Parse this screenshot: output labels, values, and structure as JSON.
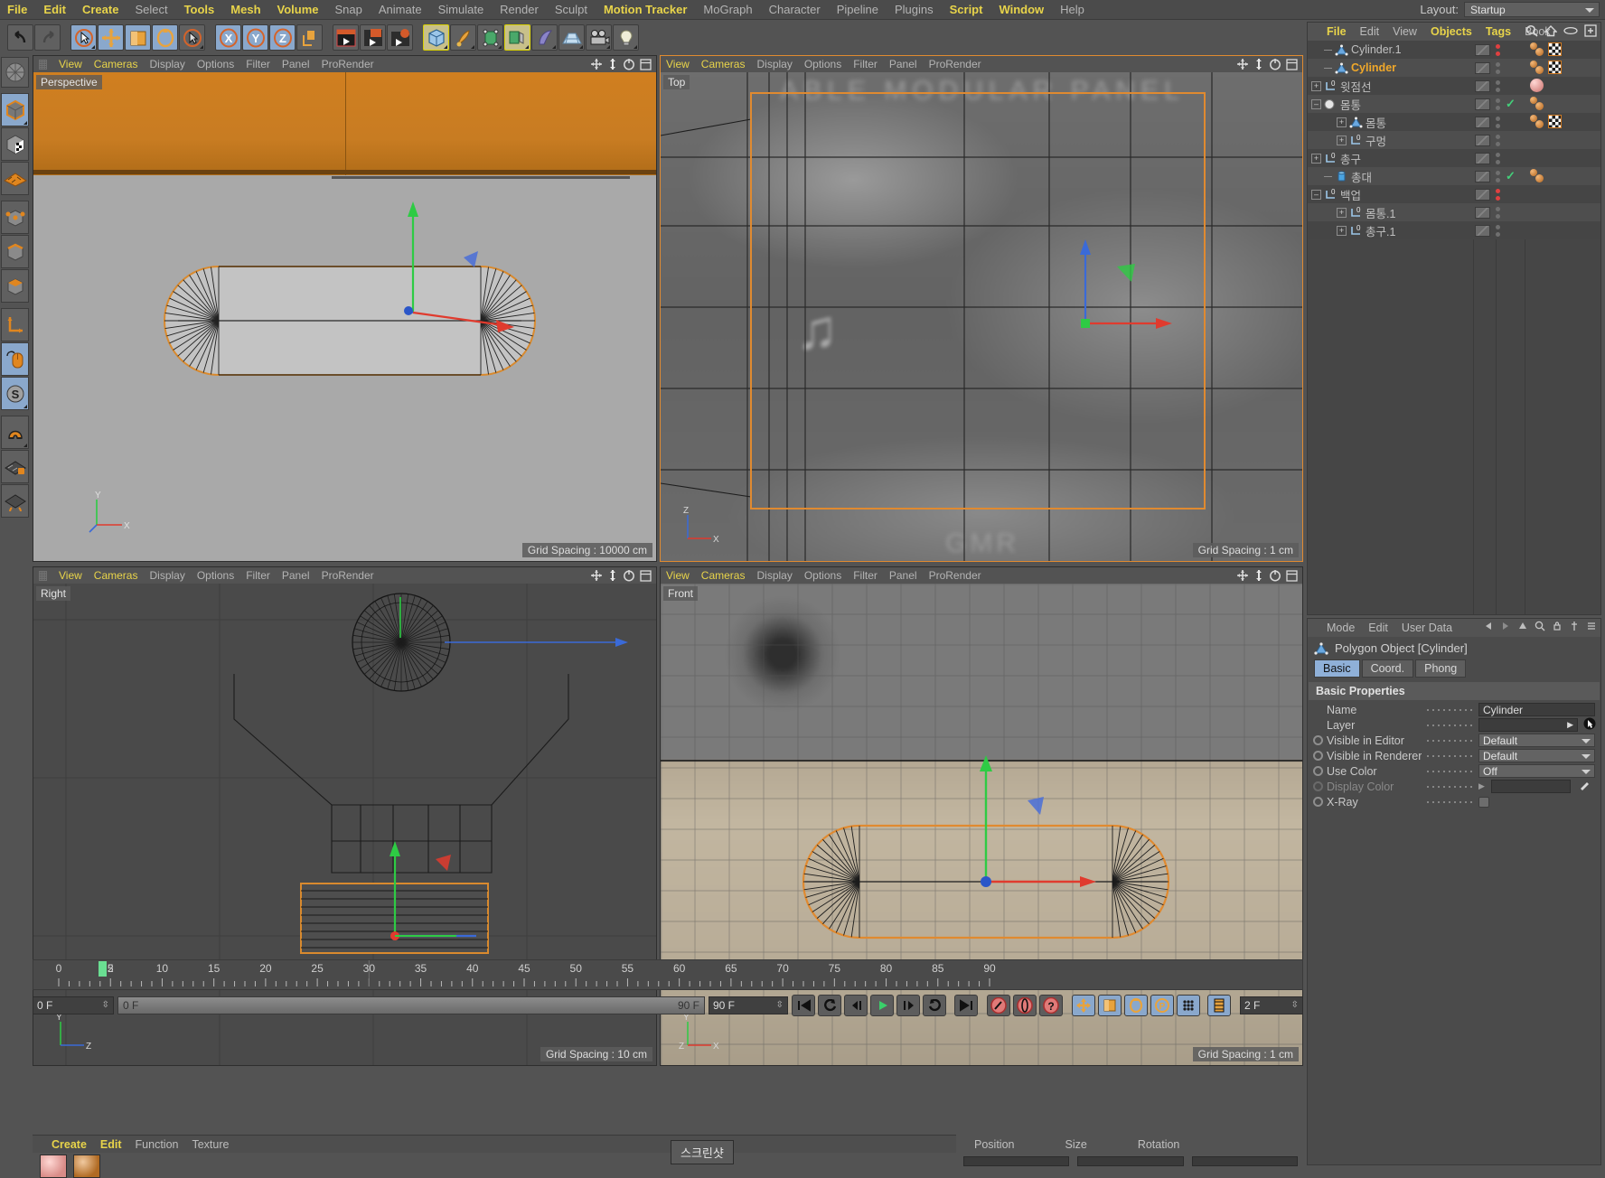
{
  "app": {
    "layout_label": "Layout:",
    "layout_value": "Startup"
  },
  "menubar": [
    {
      "label": "File",
      "hl": true
    },
    {
      "label": "Edit",
      "hl": true
    },
    {
      "label": "Create",
      "hl": true
    },
    {
      "label": "Select",
      "hl": false
    },
    {
      "label": "Tools",
      "hl": true
    },
    {
      "label": "Mesh",
      "hl": true
    },
    {
      "label": "Volume",
      "hl": true
    },
    {
      "label": "Snap",
      "hl": false
    },
    {
      "label": "Animate",
      "hl": false
    },
    {
      "label": "Simulate",
      "hl": false
    },
    {
      "label": "Render",
      "hl": false
    },
    {
      "label": "Sculpt",
      "hl": false
    },
    {
      "label": "Motion Tracker",
      "hl": true
    },
    {
      "label": "MoGraph",
      "hl": false
    },
    {
      "label": "Character",
      "hl": false
    },
    {
      "label": "Pipeline",
      "hl": false
    },
    {
      "label": "Plugins",
      "hl": false
    },
    {
      "label": "Script",
      "hl": true
    },
    {
      "label": "Window",
      "hl": true
    },
    {
      "label": "Help",
      "hl": false
    }
  ],
  "toolbar": {
    "groups": [
      {
        "buttons": [
          {
            "icon": "undo-icon",
            "active": false
          },
          {
            "icon": "redo-icon",
            "active": false
          }
        ]
      },
      {
        "buttons": [
          {
            "icon": "live-selection-icon",
            "active": true
          },
          {
            "icon": "move-icon",
            "active": true
          },
          {
            "icon": "scale-icon",
            "active": true
          },
          {
            "icon": "rotate-icon",
            "active": true
          },
          {
            "icon": "selection-mode-icon",
            "active": false
          }
        ]
      },
      {
        "buttons": [
          {
            "icon": "x-axis-lock-icon",
            "active": true
          },
          {
            "icon": "y-axis-lock-icon",
            "active": true
          },
          {
            "icon": "z-axis-lock-icon",
            "active": true
          },
          {
            "icon": "world-object-coord-icon",
            "active": false
          }
        ]
      },
      {
        "buttons": [
          {
            "icon": "render-view-icon",
            "active": false
          },
          {
            "icon": "render-region-icon",
            "active": false
          },
          {
            "icon": "render-settings-icon",
            "active": false
          }
        ]
      },
      {
        "buttons": [
          {
            "icon": "cube-primitive-icon",
            "active": false,
            "highlight": true
          },
          {
            "icon": "spline-pen-icon",
            "active": false
          },
          {
            "icon": "generator-icon",
            "active": false
          },
          {
            "icon": "array-icon",
            "active": false,
            "highlight": true
          },
          {
            "icon": "bend-deformer-icon",
            "active": false
          },
          {
            "icon": "floor-environment-icon",
            "active": false
          },
          {
            "icon": "camera-icon",
            "active": false
          },
          {
            "icon": "light-icon",
            "active": false
          }
        ]
      }
    ]
  },
  "left_toolbar": [
    {
      "icon": "texture-axis-icon",
      "active": false
    },
    {
      "icon": "model-mode-icon",
      "active": true
    },
    {
      "icon": "texture-mode-icon",
      "active": false
    },
    {
      "icon": "polygon-mode-icon",
      "active": false
    },
    {
      "icon": "point-mode-icon",
      "active": false
    },
    {
      "icon": "edge-mode-icon",
      "active": false
    },
    {
      "icon": "face-mode-icon",
      "active": false
    },
    {
      "icon": "object-axis-icon",
      "active": false
    },
    {
      "icon": "viewport-solo-icon",
      "active": true
    },
    {
      "icon": "soft-selection-icon",
      "active": true
    },
    {
      "icon": "magnet-icon",
      "active": false
    },
    {
      "icon": "workplane-lock-icon",
      "active": false
    },
    {
      "icon": "workplane-rotate-icon",
      "active": false
    }
  ],
  "viewport_menu": [
    "View",
    "Cameras",
    "Display",
    "Options",
    "Filter",
    "Panel",
    "ProRender"
  ],
  "viewports": [
    {
      "name": "Perspective",
      "grid_spacing": "Grid Spacing : 10000 cm",
      "selected": false
    },
    {
      "name": "Top",
      "grid_spacing": "Grid Spacing : 1 cm",
      "selected": true
    },
    {
      "name": "Right",
      "grid_spacing": "Grid Spacing : 10 cm",
      "selected": false
    },
    {
      "name": "Front",
      "grid_spacing": "Grid Spacing : 1 cm",
      "selected": false
    }
  ],
  "object_manager": {
    "menu": [
      "File",
      "Edit",
      "View",
      "Objects",
      "Tags",
      "Book"
    ],
    "menu_highlight": [
      "File",
      "Objects",
      "Tags"
    ],
    "icons": [
      "search-icon",
      "home-icon",
      "eye-icon",
      "plus-icon"
    ],
    "rows": [
      {
        "name": "Cylinder.1",
        "icon": "polygon-object-icon",
        "indent": 1,
        "expand": "none",
        "dots": "red",
        "check": false,
        "tags": [
          "material-tag",
          "uvw-tag"
        ],
        "selected": false
      },
      {
        "name": "Cylinder",
        "icon": "polygon-object-icon",
        "indent": 1,
        "expand": "none",
        "dots": "grey",
        "check": false,
        "tags": [
          "material-tag",
          "uvw-tag"
        ],
        "selected": true
      },
      {
        "name": "윗점선",
        "icon": "null-object-icon",
        "indent": 0,
        "expand": "plus",
        "dots": "grey",
        "check": false,
        "tags": [
          "material-pink-tag"
        ],
        "selected": false
      },
      {
        "name": "몸통",
        "icon": "boole-object-icon",
        "indent": 0,
        "expand": "minus",
        "dots": "grey",
        "check": true,
        "tags": [
          "material-tag"
        ],
        "selected": false
      },
      {
        "name": "몸통",
        "icon": "polygon-object-icon",
        "indent": 2,
        "expand": "plus",
        "dots": "grey",
        "check": false,
        "tags": [
          "material-tag",
          "uvw-tag"
        ],
        "selected": false
      },
      {
        "name": "구멍",
        "icon": "null-object-icon",
        "indent": 2,
        "expand": "plus",
        "dots": "grey",
        "check": false,
        "tags": [],
        "selected": false
      },
      {
        "name": "총구",
        "icon": "null-object-icon",
        "indent": 0,
        "expand": "plus",
        "dots": "grey",
        "check": false,
        "tags": [],
        "selected": false
      },
      {
        "name": "총대",
        "icon": "cylinder-object-icon",
        "indent": 1,
        "expand": "none",
        "dots": "grey",
        "check": true,
        "tags": [
          "material-tag"
        ],
        "selected": false
      },
      {
        "name": "백업",
        "icon": "null-object-icon",
        "indent": 0,
        "expand": "minus",
        "dots": "red",
        "check": false,
        "tags": [],
        "selected": false
      },
      {
        "name": "몸통.1",
        "icon": "null-object-icon",
        "indent": 2,
        "expand": "plus",
        "dots": "grey",
        "check": false,
        "tags": [],
        "selected": false
      },
      {
        "name": "총구.1",
        "icon": "null-object-icon",
        "indent": 2,
        "expand": "plus",
        "dots": "grey",
        "check": false,
        "tags": [],
        "selected": false
      }
    ]
  },
  "attribute_manager": {
    "menu": [
      "Mode",
      "Edit",
      "User Data"
    ],
    "header_icons": [
      "back-arrow-icon",
      "forward-arrow-icon",
      "up-arrow-icon",
      "search-icon",
      "lock-icon",
      "pin-icon",
      "menu-icon"
    ],
    "object_title": "Polygon Object [Cylinder]",
    "tabs": [
      {
        "label": "Basic",
        "active": true
      },
      {
        "label": "Coord.",
        "active": false
      },
      {
        "label": "Phong",
        "active": false
      }
    ],
    "section_title": "Basic Properties",
    "properties": [
      {
        "label": "Name",
        "value": "Cylinder",
        "type": "text",
        "radio": false
      },
      {
        "label": "Layer",
        "value": "",
        "type": "layer",
        "radio": false
      },
      {
        "label": "Visible in Editor",
        "value": "Default",
        "type": "combo",
        "radio": true
      },
      {
        "label": "Visible in Renderer",
        "value": "Default",
        "type": "combo",
        "radio": true
      },
      {
        "label": "Use Color",
        "value": "Off",
        "type": "combo",
        "radio": true
      },
      {
        "label": "Display Color",
        "value": "",
        "type": "color",
        "radio": true,
        "disabled": true
      },
      {
        "label": "X-Ray",
        "value": "",
        "type": "checkbox",
        "radio": true
      }
    ]
  },
  "timeline": {
    "ticks": [
      0,
      5,
      10,
      15,
      20,
      25,
      30,
      35,
      40,
      45,
      50,
      55,
      60,
      65,
      70,
      75,
      80,
      85,
      90
    ],
    "current_frame_label": "2",
    "start_field": "0 F",
    "range_start": "0 F",
    "range_end": "90 F",
    "end_field": "90 F",
    "step_field": "2 F",
    "playback_buttons": [
      {
        "icon": "go-to-start-icon",
        "active": false
      },
      {
        "icon": "previous-keyframe-icon",
        "active": false
      },
      {
        "icon": "step-back-icon",
        "active": false
      },
      {
        "icon": "play-icon",
        "active": false
      },
      {
        "icon": "step-forward-icon",
        "active": false
      },
      {
        "icon": "next-keyframe-icon",
        "active": false
      },
      {
        "icon": "go-to-end-icon",
        "active": false
      }
    ],
    "record_buttons": [
      {
        "icon": "record-keyframe-icon",
        "active": false
      },
      {
        "icon": "autokey-icon",
        "active": false
      },
      {
        "icon": "keyframe-selection-icon",
        "active": false
      }
    ],
    "toggle_buttons": [
      {
        "icon": "position-key-icon",
        "active": true
      },
      {
        "icon": "scale-key-icon",
        "active": true
      },
      {
        "icon": "rotation-key-icon",
        "active": true
      },
      {
        "icon": "param-key-icon",
        "active": true
      },
      {
        "icon": "pla-key-icon",
        "active": true
      },
      {
        "icon": "timeline-icon",
        "active": true
      }
    ]
  },
  "material_manager": {
    "menu": [
      "Create",
      "Edit",
      "Function",
      "Texture"
    ],
    "menu_highlight": [
      "Create",
      "Edit"
    ]
  },
  "coordinate_manager": {
    "columns": [
      "Position",
      "Size",
      "Rotation"
    ]
  },
  "tooltip": {
    "text": "스크린샷"
  },
  "colors": {
    "accent_yellow": "#e8d44a",
    "selected_orange": "#f0a82a",
    "active_blue": "#8aa8cc",
    "panel_bg": "#535353",
    "viewport_bg": "#3c3c3c",
    "orange_object": "#e08a30"
  }
}
